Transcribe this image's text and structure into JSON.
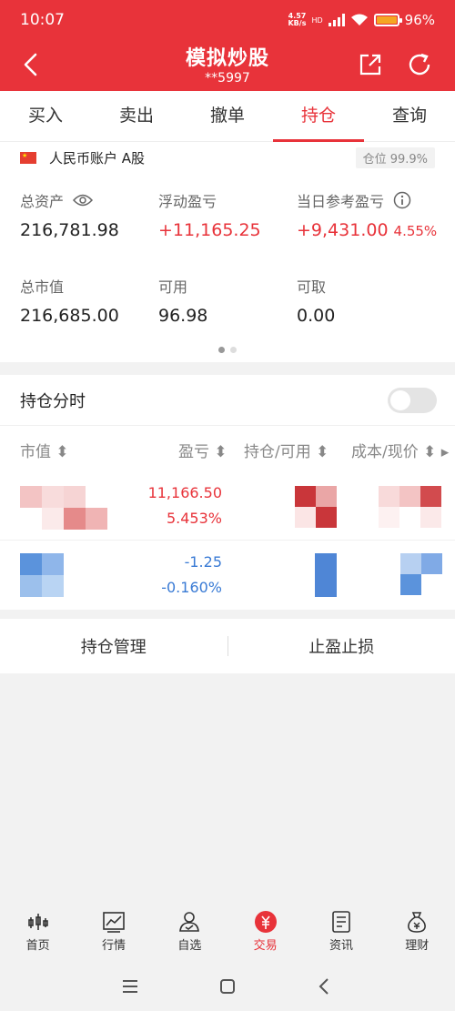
{
  "status": {
    "time": "10:07",
    "net_speed_top": "4.57",
    "net_speed_bottom": "KB/s",
    "battery": "96%"
  },
  "header": {
    "title": "模拟炒股",
    "account": "**5997"
  },
  "tabs": [
    "买入",
    "卖出",
    "撤单",
    "持仓",
    "查询"
  ],
  "account": {
    "name": "人民币账户 A股",
    "position_label": "仓位 99.9%",
    "stats": [
      {
        "label": "总资产",
        "value": "216,781.98"
      },
      {
        "label": "浮动盈亏",
        "value": "+11,165.25"
      },
      {
        "label": "当日参考盈亏",
        "value": "+9,431.00",
        "pct": "4.55%"
      },
      {
        "label": "总市值",
        "value": "216,685.00"
      },
      {
        "label": "可用",
        "value": "96.98"
      },
      {
        "label": "可取",
        "value": "0.00"
      }
    ]
  },
  "holdings": {
    "section_title": "持仓分时",
    "columns": [
      "市值",
      "盈亏",
      "持仓/可用",
      "成本/现价"
    ],
    "rows": [
      {
        "pnl": "11,166.50",
        "pnl_pct": "5.453%"
      },
      {
        "pnl": "-1.25",
        "pnl_pct": "-0.160%"
      }
    ]
  },
  "actions": {
    "manage": "持仓管理",
    "stop": "止盈止损"
  },
  "nav": [
    "首页",
    "行情",
    "自选",
    "交易",
    "资讯",
    "理财"
  ],
  "colors": {
    "brand": "#e8333a",
    "down": "#3a7bd5"
  }
}
